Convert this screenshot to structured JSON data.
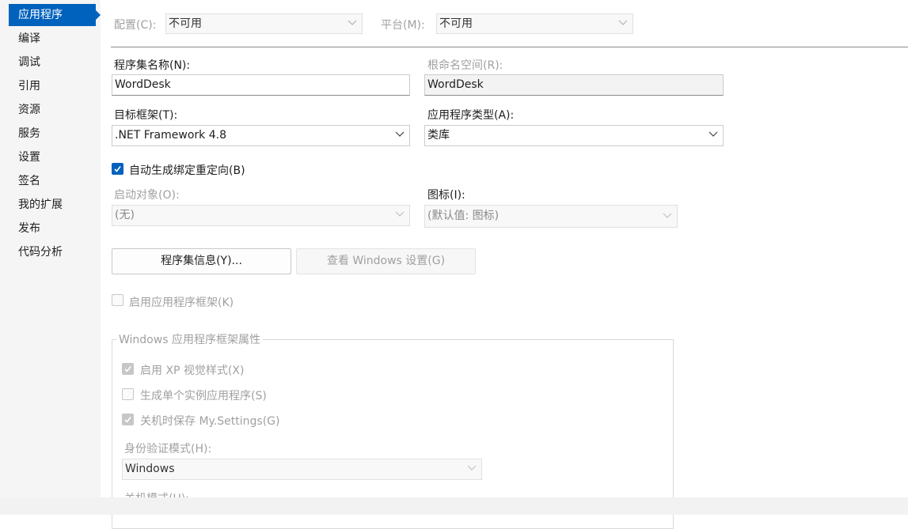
{
  "sidebar": {
    "items": [
      {
        "label": "应用程序",
        "active": true
      },
      {
        "label": "编译"
      },
      {
        "label": "调试"
      },
      {
        "label": "引用"
      },
      {
        "label": "资源"
      },
      {
        "label": "服务"
      },
      {
        "label": "设置"
      },
      {
        "label": "签名"
      },
      {
        "label": "我的扩展"
      },
      {
        "label": "发布"
      },
      {
        "label": "代码分析"
      }
    ]
  },
  "topbar": {
    "config_label": "配置(C):",
    "config_value": "不可用",
    "platform_label": "平台(M):",
    "platform_value": "不可用"
  },
  "form": {
    "assembly_name_label": "程序集名称(N):",
    "assembly_name_value": "WordDesk",
    "root_namespace_label": "根命名空间(R):",
    "root_namespace_value": "WordDesk",
    "target_framework_label": "目标框架(T):",
    "target_framework_value": ".NET Framework 4.8",
    "app_type_label": "应用程序类型(A):",
    "app_type_value": "类库",
    "auto_binding_label": "自动生成绑定重定向(B)",
    "auto_binding_checked": true,
    "startup_object_label": "启动对象(O):",
    "startup_object_value": "(无)",
    "icon_label": "图标(I):",
    "icon_value": "(默认值: 图标)",
    "assembly_info_button": "程序集信息(Y)...",
    "windows_settings_button": "查看 Windows 设置(G)",
    "enable_framework_label": "启用应用程序框架(K)",
    "enable_framework_checked": false
  },
  "framework_group": {
    "title": "Windows 应用程序框架属性",
    "xp_styles_label": "启用 XP 视觉样式(X)",
    "xp_styles_checked": true,
    "single_instance_label": "生成单个实例应用程序(S)",
    "single_instance_checked": false,
    "save_settings_label": "关机时保存 My.Settings(G)",
    "save_settings_checked": true,
    "auth_mode_label": "身份验证模式(H):",
    "auth_mode_value": "Windows",
    "shutdown_mode_label": "关机模式(U):"
  },
  "colors": {
    "accent": "#0062bd"
  }
}
